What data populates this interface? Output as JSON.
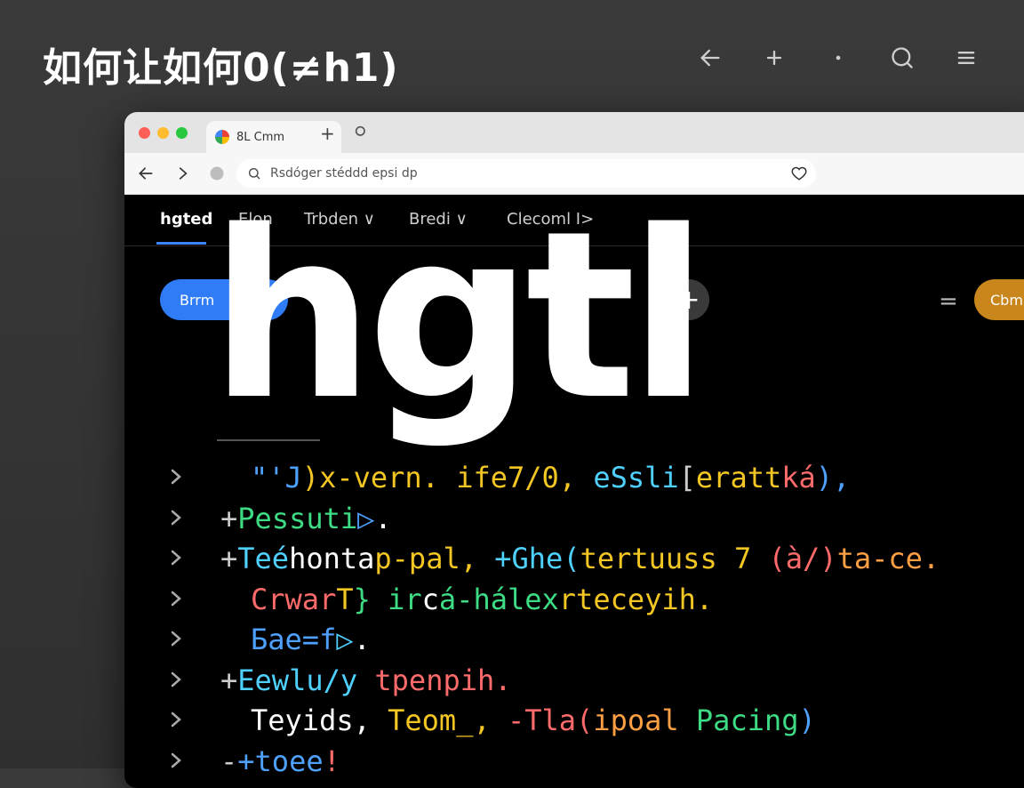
{
  "slide": {
    "title": "如何让如何0(≠h1)"
  },
  "top_icons": [
    "back-arrow-icon",
    "plus-icon",
    "dot-icon",
    "search-icon",
    "menu-icon"
  ],
  "browser": {
    "tab_title": "8L Cmm",
    "new_tab": "+",
    "address": "Rsdóger stéddd epsi  dp",
    "nav": {
      "items": [
        "hgted",
        "Elon",
        "Trbden ∨",
        "Bredi ∨",
        "Clecoml I>"
      ],
      "active_index": 0
    },
    "pill_blue_label": "Brrm",
    "pill_orange_label": "Cbm",
    "hero_text": "hgtl"
  },
  "code_lines": [
    {
      "prefix": "",
      "segments": [
        [
          "c-blue",
          "\"'J"
        ],
        [
          "c-yellow",
          ")x-vern. ife7/0, "
        ],
        [
          "c-cyan",
          "eSsli"
        ],
        [
          "c-gray",
          "["
        ],
        [
          "c-yellow",
          "eratt"
        ],
        [
          "c-red",
          "ká"
        ],
        [
          "c-blue",
          "),"
        ]
      ]
    },
    {
      "prefix": "+",
      "segments": [
        [
          "c-green",
          "Pessuti"
        ],
        [
          "c-blue",
          "▷"
        ],
        [
          "c-white",
          "."
        ]
      ]
    },
    {
      "prefix": "+",
      "segments": [
        [
          "c-cyan",
          "Teé"
        ],
        [
          "c-white",
          "honta"
        ],
        [
          "c-yellow",
          "p-pal, "
        ],
        [
          "c-cyan",
          "+Ghe("
        ],
        [
          "c-yellow",
          "tertuuss 7 "
        ],
        [
          "c-red",
          "(à/)"
        ],
        [
          "c-orange",
          "ta-ce."
        ]
      ]
    },
    {
      "prefix": "",
      "segments": [
        [
          "c-red",
          "Crwar"
        ],
        [
          "c-yellow",
          "T"
        ],
        [
          "c-green",
          "}  ir"
        ],
        [
          "c-white",
          "c"
        ],
        [
          "c-green",
          "á-hálex"
        ],
        [
          "c-yellow",
          "rteceyih."
        ]
      ]
    },
    {
      "prefix": "",
      "segments": [
        [
          "c-blue",
          "Бae=f"
        ],
        [
          "c-cyan",
          "▷"
        ],
        [
          "c-white",
          "."
        ]
      ]
    },
    {
      "prefix": "+",
      "segments": [
        [
          "c-cyan",
          "Eewlu/y "
        ],
        [
          "c-red",
          "tpenpih."
        ]
      ]
    },
    {
      "prefix": "",
      "segments": [
        [
          "c-white",
          "Teyids, "
        ],
        [
          "c-yellow",
          "Teom_, "
        ],
        [
          "c-red",
          "-Tla("
        ],
        [
          "c-orange",
          "ipoal "
        ],
        [
          "c-green",
          "Pacing"
        ],
        [
          "c-blue",
          ")"
        ]
      ]
    },
    {
      "prefix": "-",
      "segments": [
        [
          "c-blue",
          "+toee"
        ],
        [
          "c-red",
          "!"
        ]
      ]
    }
  ],
  "colors": {
    "accent_blue": "#2f7cf6",
    "accent_orange": "#c8861c"
  }
}
